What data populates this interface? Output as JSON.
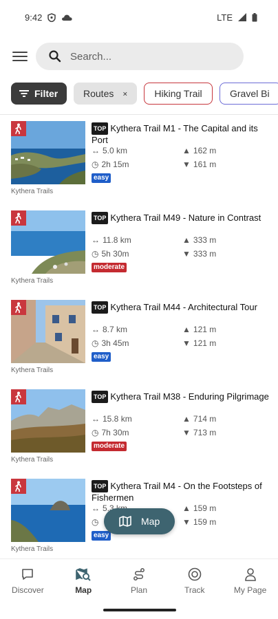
{
  "status": {
    "time": "9:42",
    "network": "LTE"
  },
  "search": {
    "placeholder": "Search..."
  },
  "chips": [
    {
      "label": "Filter"
    },
    {
      "label": "Routes"
    },
    {
      "label": "Hiking Trail"
    },
    {
      "label": "Gravel Bi"
    }
  ],
  "tours": [
    {
      "top": "TOP",
      "title": "Kythera Trail M1 - The Capital and its Port",
      "distance": "5.0 km",
      "duration": "2h 15m",
      "ascent": "162 m",
      "descent": "161 m",
      "difficulty": "easy",
      "source": "Kythera Trails"
    },
    {
      "top": "TOP",
      "title": "Kythera Trail M49 - Nature in Contrast",
      "distance": "11.8 km",
      "duration": "5h 30m",
      "ascent": "333 m",
      "descent": "333 m",
      "difficulty": "moderate",
      "source": "Kythera Trails"
    },
    {
      "top": "TOP",
      "title": "Kythera Trail M44 - Architectural Tour",
      "distance": "8.7 km",
      "duration": "3h 45m",
      "ascent": "121 m",
      "descent": "121 m",
      "difficulty": "easy",
      "source": "Kythera Trails"
    },
    {
      "top": "TOP",
      "title": "Kythera Trail M38 - Enduring Pilgrimage",
      "distance": "15.8 km",
      "duration": "7h 30m",
      "ascent": "714 m",
      "descent": "713 m",
      "difficulty": "moderate",
      "source": "Kythera Trails"
    },
    {
      "top": "TOP",
      "title": "Kythera Trail M4 - On the Footsteps of Fishermen",
      "distance": "5.3 km",
      "duration": "",
      "ascent": "159 m",
      "descent": "159 m",
      "difficulty": "easy",
      "source": "Kythera Trails"
    }
  ],
  "fab": {
    "label": "Map"
  },
  "nav": [
    {
      "label": "Discover"
    },
    {
      "label": "Map"
    },
    {
      "label": "Plan"
    },
    {
      "label": "Track"
    },
    {
      "label": "My Page"
    }
  ],
  "colors": {
    "hiking": "#c9373e",
    "easy": "#1f5ec9",
    "moderate": "#c42a30",
    "fab": "#3e6470"
  }
}
